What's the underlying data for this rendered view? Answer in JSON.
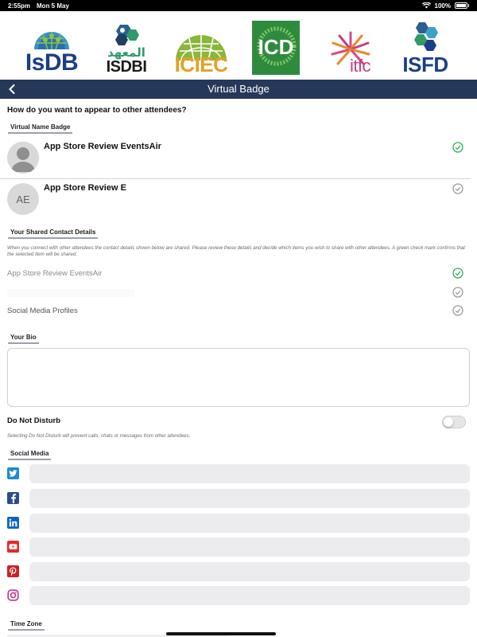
{
  "status_bar": {
    "time": "2:55pm",
    "date": "Mon 5 May",
    "battery": "100%"
  },
  "logos": [
    {
      "text": "IsDB",
      "color": "#1b3f86",
      "icon": "globe-logo-icon"
    },
    {
      "text": "ISDBI",
      "arabic": "المعهد",
      "color": "#1b1b1b",
      "icon": "hexagon-logo-icon"
    },
    {
      "text": "ICIEC",
      "color": "#8ab63b",
      "icon": "globe-logo-icon"
    },
    {
      "text": "ICD",
      "color": "#2e8b3e",
      "icon": "square-logo-icon"
    },
    {
      "text": "itfc",
      "color": "#c0417e",
      "icon": "starburst-logo-icon"
    },
    {
      "text": "ISFD",
      "color": "#1b3f86",
      "icon": "hexagon-logo-icon"
    }
  ],
  "nav": {
    "title": "Virtual Badge",
    "back_icon": "chevron-left-icon",
    "color": "#26385a"
  },
  "question": "How do you want to appear to other attendees?",
  "sections": {
    "badge": "Virtual Name Badge",
    "contact": "Your Shared Contact Details",
    "bio": "Your Bio",
    "social": "Social Media",
    "timezone": "Time Zone"
  },
  "badges": [
    {
      "name": "App Store Review EventsAir",
      "avatar": "person-silhouette-icon",
      "selected": true
    },
    {
      "name": "App Store Review E",
      "initials": "AE",
      "selected": false
    }
  ],
  "shared_description": "When you connect with other attendees the contact details shown below are shared. Please review these details and decide which items you wish to share with other attendees. A green check mark confirms that the selected item will be shared.",
  "contact_items": [
    {
      "label": "App Store Review EventsAir",
      "selected": true
    },
    {
      "label": "",
      "selected": false
    },
    {
      "label": "Social Media Profiles",
      "selected": false
    }
  ],
  "bio": {
    "value": ""
  },
  "dnd": {
    "label": "Do Not Disturb",
    "description": "Selecting Do Not Disturb will prevent calls, chats or messages from other attendees.",
    "enabled": false
  },
  "social": [
    {
      "network": "twitter",
      "icon": "twitter-icon",
      "color": "#1d8bd0",
      "value": ""
    },
    {
      "network": "facebook",
      "icon": "facebook-icon",
      "color": "#2a4b8d",
      "value": ""
    },
    {
      "network": "linkedin",
      "icon": "linkedin-icon",
      "color": "#0a66c2",
      "value": ""
    },
    {
      "network": "youtube",
      "icon": "youtube-icon",
      "color": "#e52d27",
      "value": ""
    },
    {
      "network": "pinterest",
      "icon": "pinterest-icon",
      "color": "#cb2027",
      "value": ""
    },
    {
      "network": "instagram",
      "icon": "instagram-icon",
      "color": "#c13584",
      "value": ""
    }
  ],
  "colors": {
    "check_selected": "#2fae5c",
    "check_unselected": "#9a9a9a"
  }
}
